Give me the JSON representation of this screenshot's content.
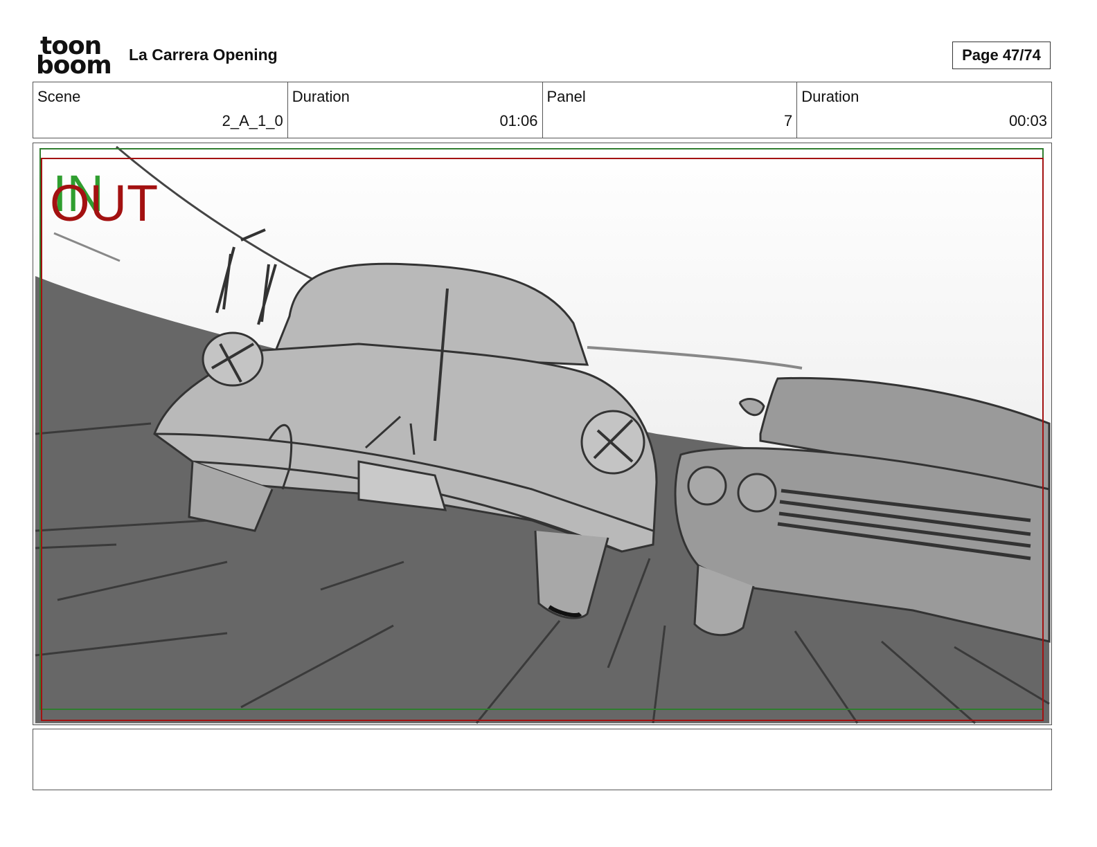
{
  "header": {
    "logo": {
      "line1": "toon",
      "line2": "boom"
    },
    "title": "La Carrera Opening",
    "page_label": "Page 47/74"
  },
  "info": {
    "scene_label": "Scene",
    "scene_value": "2_A_1_0",
    "scene_duration_label": "Duration",
    "scene_duration_value": "01:06",
    "panel_label": "Panel",
    "panel_value": "7",
    "panel_duration_label": "Duration",
    "panel_duration_value": "00:03"
  },
  "panel": {
    "in_marker": "IN",
    "out_marker": "OUT",
    "colors": {
      "in": "#2f9e2f",
      "out": "#a31111",
      "sky_top": "#ffffff",
      "sky_bottom": "#e3e3e3",
      "road": "#676767",
      "car_front": "#b9b9b9",
      "car_right": "#9a9a9a"
    }
  },
  "caption": {
    "text": ""
  }
}
